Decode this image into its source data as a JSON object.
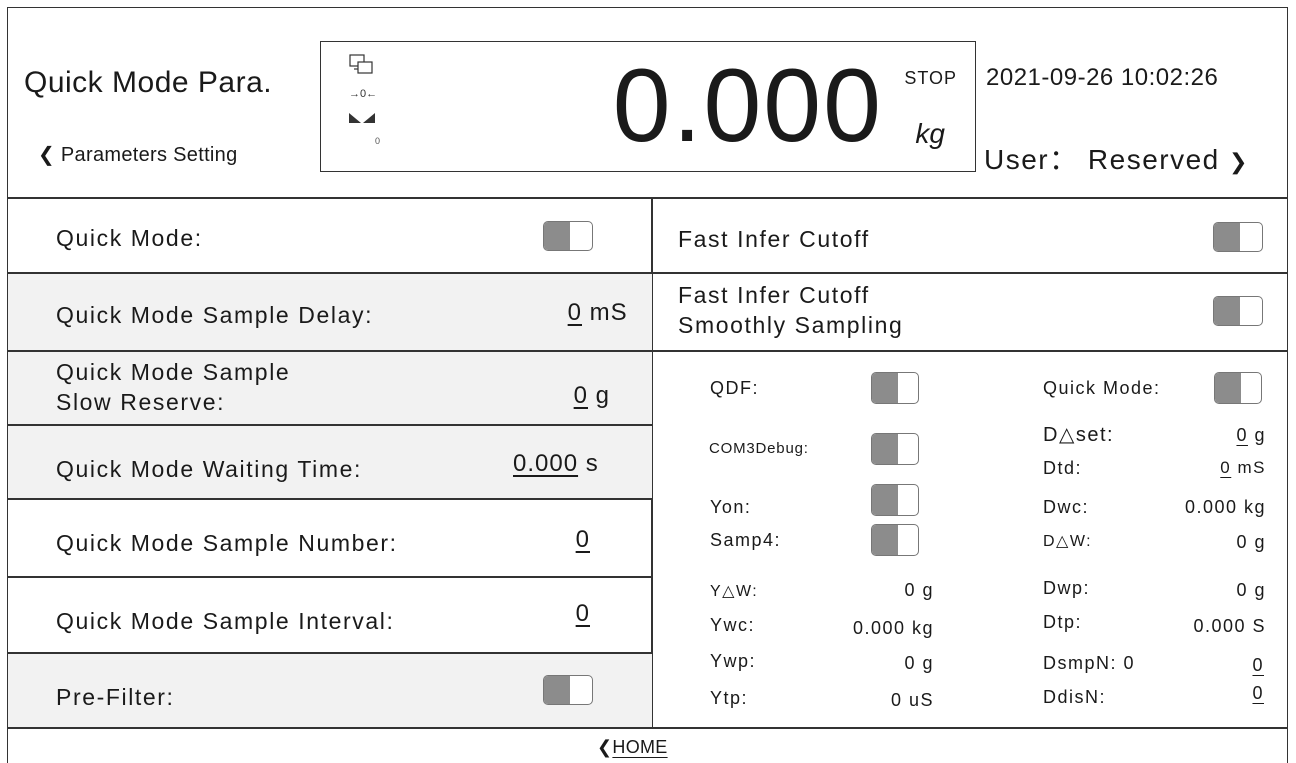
{
  "header": {
    "title": "Quick  Mode Para.",
    "back_label": "Parameters Setting",
    "weight": "0.000",
    "weight_status": "STOP",
    "weight_unit": "kg",
    "zero_indicator": "→0←",
    "zero_count": "0",
    "datetime": "2021-09-26 10:02:26",
    "user_label": "User： Reserved"
  },
  "left_rows": [
    {
      "label": "Quick Mode:"
    },
    {
      "label": "Quick Mode Sample Delay:",
      "value": "0",
      "unit": "mS"
    },
    {
      "label_line1": "Quick Mode Sample",
      "label_line2": "Slow Reserve:",
      "value": "0",
      "unit": "g"
    },
    {
      "label": "Quick Mode Waiting Time:",
      "value": "0.000",
      "unit": "s"
    },
    {
      "label": "Quick Mode Sample Number:",
      "value": "0"
    },
    {
      "label": "Quick Mode Sample Interval:",
      "value": "0"
    },
    {
      "label": "Pre-Filter:"
    }
  ],
  "right": {
    "fast_infer_cutoff": "Fast Infer Cutoff",
    "fast_infer_smooth_1": "Fast Infer Cutoff",
    "fast_infer_smooth_2": "Smoothly Sampling",
    "qdf": "QDF:",
    "com3debug": "COM3Debug:",
    "yon": "Yon:",
    "samp4": "Samp4:",
    "quick_mode": "Quick Mode:",
    "dset_label": "D△set:",
    "dset_value": "0",
    "dset_unit": "g",
    "dtd_label": "Dtd:",
    "dtd_value": "0",
    "dtd_unit": "mS",
    "dwc_label": "Dwc:",
    "dwc_value": "0.000  kg",
    "ddw_label": "D△W:",
    "ddw_value": "0  g",
    "ydw_label": "Y△W:",
    "ydw_value": "0  g",
    "ywc_label": "Ywc:",
    "ywc_value": "0.000  kg",
    "ywp_label": "Ywp:",
    "ywp_value": "0  g",
    "ytp_label": "Ytp:",
    "ytp_value": "0  uS",
    "dwp_label": "Dwp:",
    "dwp_value": "0  g",
    "dtp_label": "Dtp:",
    "dtp_value": "0.000 S",
    "dsmpn_label": "DsmpN: 0",
    "dsmpn_value": "0",
    "ddisn_label": "DdisN:",
    "ddisn_value": "0"
  },
  "footer": {
    "home_label": "HOME"
  }
}
